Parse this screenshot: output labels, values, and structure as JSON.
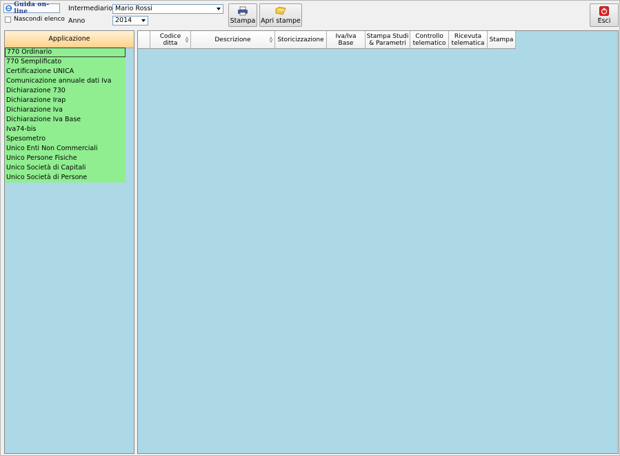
{
  "toolbar": {
    "guida_label": "Guida on-line",
    "nascondi_label": "Nascondi elenco",
    "intermediario_label": "Intermediario",
    "intermediario_value": "Mario Rossi",
    "anno_label": "Anno",
    "anno_value": "2014",
    "stampa_label": "Stampa",
    "apri_stampe_label": "Apri stampe",
    "esci_label": "Esci"
  },
  "sidebar": {
    "header": "Applicazione",
    "items": [
      "770 Ordinario",
      "770 Semplificato",
      "Certificazione UNICA",
      "Comunicazione annuale dati Iva",
      "Dichiarazione 730",
      "Dichiarazione Irap",
      "Dichiarazione Iva",
      "Dichiarazione Iva Base",
      "Iva74-bis",
      "Spesometro",
      "Unico Enti Non Commerciali",
      "Unico Persone Fisiche",
      "Unico Società di Capitali",
      "Unico Società di Persone"
    ]
  },
  "grid": {
    "columns": [
      "",
      "Codice ditta",
      "Descrizione",
      "Storicizzazione",
      "Iva/Iva Base",
      "Stampa Studi & Parametri",
      "Controllo telematico",
      "Ricevuta telematica",
      "Stampa"
    ],
    "sort_symbol": "◊"
  },
  "colors": {
    "list_item": "#90ee90",
    "panel_bg": "#add8e6",
    "header_gradient": "#ffd18a"
  }
}
